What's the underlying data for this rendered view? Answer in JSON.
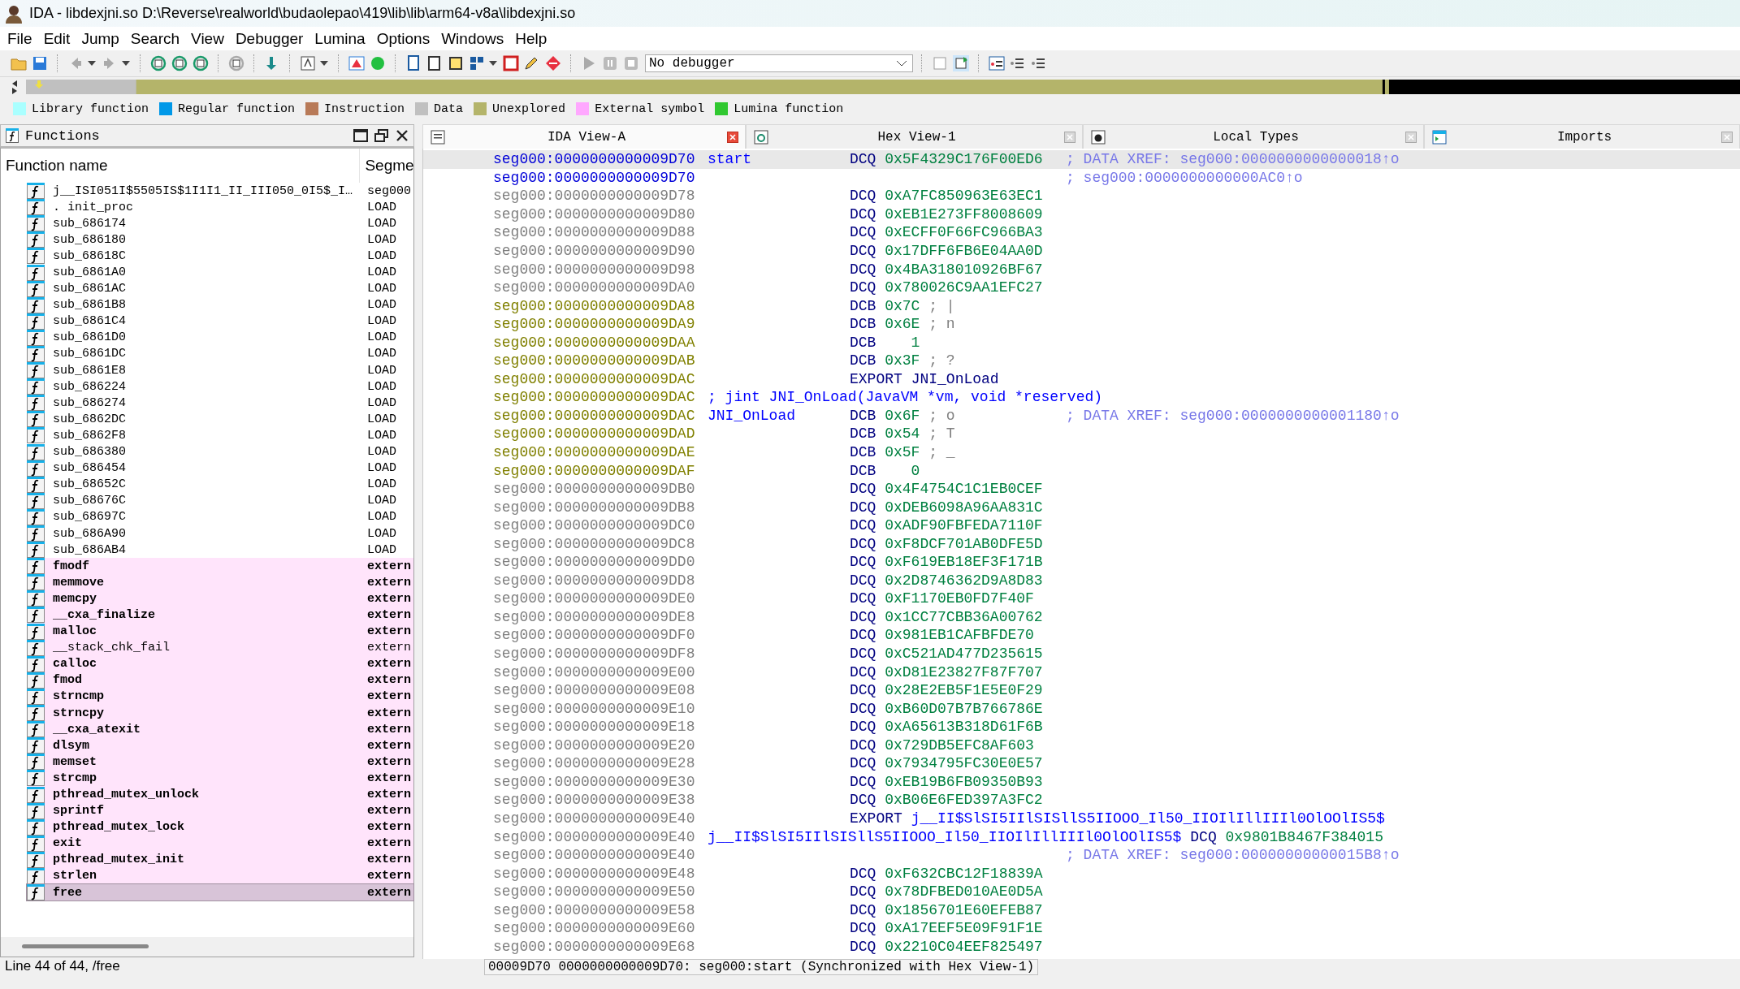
{
  "window": {
    "title": "IDA - libdexjni.so D:\\Reverse\\realworld\\budaolepao\\419\\lib\\lib\\arm64-v8a\\libdexjni.so"
  },
  "menu": [
    "File",
    "Edit",
    "Jump",
    "Search",
    "View",
    "Debugger",
    "Lumina",
    "Options",
    "Windows",
    "Help"
  ],
  "debugger_select": {
    "value": "No debugger"
  },
  "legend": [
    {
      "label": "Library function",
      "color": "#aaffff"
    },
    {
      "label": "Regular function",
      "color": "#0098e8"
    },
    {
      "label": "Instruction",
      "color": "#b87a58"
    },
    {
      "label": "Data",
      "color": "#c0c0c0"
    },
    {
      "label": "Unexplored",
      "color": "#b4b46a"
    },
    {
      "label": "External symbol",
      "color": "#ffa8ff"
    },
    {
      "label": "Lumina function",
      "color": "#30c830"
    }
  ],
  "functions_panel": {
    "title": "Functions",
    "columns": [
      "Function name",
      "Segme"
    ],
    "rows": [
      {
        "name": "j__ISI051I$5505IS$1I1I1_II_III050_0I5$_I…",
        "segment": "seg000",
        "kind": "local",
        "bold": false,
        "selected": false
      },
      {
        "name": ". init_proc",
        "segment": "LOAD",
        "kind": "local",
        "bold": false,
        "selected": false
      },
      {
        "name": "sub_686174",
        "segment": "LOAD",
        "kind": "local",
        "bold": false,
        "selected": false
      },
      {
        "name": "sub_686180",
        "segment": "LOAD",
        "kind": "local",
        "bold": false,
        "selected": false
      },
      {
        "name": "sub_68618C",
        "segment": "LOAD",
        "kind": "local",
        "bold": false,
        "selected": false
      },
      {
        "name": "sub_6861A0",
        "segment": "LOAD",
        "kind": "local",
        "bold": false,
        "selected": false
      },
      {
        "name": "sub_6861AC",
        "segment": "LOAD",
        "kind": "local",
        "bold": false,
        "selected": false
      },
      {
        "name": "sub_6861B8",
        "segment": "LOAD",
        "kind": "local",
        "bold": false,
        "selected": false
      },
      {
        "name": "sub_6861C4",
        "segment": "LOAD",
        "kind": "local",
        "bold": false,
        "selected": false
      },
      {
        "name": "sub_6861D0",
        "segment": "LOAD",
        "kind": "local",
        "bold": false,
        "selected": false
      },
      {
        "name": "sub_6861DC",
        "segment": "LOAD",
        "kind": "local",
        "bold": false,
        "selected": false
      },
      {
        "name": "sub_6861E8",
        "segment": "LOAD",
        "kind": "local",
        "bold": false,
        "selected": false
      },
      {
        "name": "sub_686224",
        "segment": "LOAD",
        "kind": "local",
        "bold": false,
        "selected": false
      },
      {
        "name": "sub_686274",
        "segment": "LOAD",
        "kind": "local",
        "bold": false,
        "selected": false
      },
      {
        "name": "sub_6862DC",
        "segment": "LOAD",
        "kind": "local",
        "bold": false,
        "selected": false
      },
      {
        "name": "sub_6862F8",
        "segment": "LOAD",
        "kind": "local",
        "bold": false,
        "selected": false
      },
      {
        "name": "sub_686380",
        "segment": "LOAD",
        "kind": "local",
        "bold": false,
        "selected": false
      },
      {
        "name": "sub_686454",
        "segment": "LOAD",
        "kind": "local",
        "bold": false,
        "selected": false
      },
      {
        "name": "sub_68652C",
        "segment": "LOAD",
        "kind": "local",
        "bold": false,
        "selected": false
      },
      {
        "name": "sub_68676C",
        "segment": "LOAD",
        "kind": "local",
        "bold": false,
        "selected": false
      },
      {
        "name": "sub_68697C",
        "segment": "LOAD",
        "kind": "local",
        "bold": false,
        "selected": false
      },
      {
        "name": "sub_686A90",
        "segment": "LOAD",
        "kind": "local",
        "bold": false,
        "selected": false
      },
      {
        "name": "sub_686AB4",
        "segment": "LOAD",
        "kind": "local",
        "bold": false,
        "selected": false
      },
      {
        "name": "fmodf",
        "segment": "extern",
        "kind": "extern",
        "bold": true,
        "selected": false
      },
      {
        "name": "memmove",
        "segment": "extern",
        "kind": "extern",
        "bold": true,
        "selected": false
      },
      {
        "name": "memcpy",
        "segment": "extern",
        "kind": "extern",
        "bold": true,
        "selected": false
      },
      {
        "name": "__cxa_finalize",
        "segment": "extern",
        "kind": "extern",
        "bold": true,
        "selected": false
      },
      {
        "name": "malloc",
        "segment": "extern",
        "kind": "extern",
        "bold": true,
        "selected": false
      },
      {
        "name": "__stack_chk_fail",
        "segment": "extern",
        "kind": "extern",
        "bold": false,
        "selected": false
      },
      {
        "name": "calloc",
        "segment": "extern",
        "kind": "extern",
        "bold": true,
        "selected": false
      },
      {
        "name": "fmod",
        "segment": "extern",
        "kind": "extern",
        "bold": true,
        "selected": false
      },
      {
        "name": "strncmp",
        "segment": "extern",
        "kind": "extern",
        "bold": true,
        "selected": false
      },
      {
        "name": "strncpy",
        "segment": "extern",
        "kind": "extern",
        "bold": true,
        "selected": false
      },
      {
        "name": "__cxa_atexit",
        "segment": "extern",
        "kind": "extern",
        "bold": true,
        "selected": false
      },
      {
        "name": "dlsym",
        "segment": "extern",
        "kind": "extern",
        "bold": true,
        "selected": false
      },
      {
        "name": "memset",
        "segment": "extern",
        "kind": "extern",
        "bold": true,
        "selected": false
      },
      {
        "name": "strcmp",
        "segment": "extern",
        "kind": "extern",
        "bold": true,
        "selected": false
      },
      {
        "name": "pthread_mutex_unlock",
        "segment": "extern",
        "kind": "extern",
        "bold": true,
        "selected": false
      },
      {
        "name": "sprintf",
        "segment": "extern",
        "kind": "extern",
        "bold": true,
        "selected": false
      },
      {
        "name": "pthread_mutex_lock",
        "segment": "extern",
        "kind": "extern",
        "bold": true,
        "selected": false
      },
      {
        "name": "exit",
        "segment": "extern",
        "kind": "extern",
        "bold": true,
        "selected": false
      },
      {
        "name": "pthread_mutex_init",
        "segment": "extern",
        "kind": "extern",
        "bold": true,
        "selected": false
      },
      {
        "name": "strlen",
        "segment": "extern",
        "kind": "extern",
        "bold": true,
        "selected": false
      },
      {
        "name": "free",
        "segment": "extern",
        "kind": "extern",
        "bold": true,
        "selected": true
      }
    ],
    "status": "Line 44 of 44, /free"
  },
  "tabs": [
    {
      "label": "IDA View-A",
      "selected": true
    },
    {
      "label": "Hex View-1",
      "selected": false
    },
    {
      "label": "Local Types",
      "selected": false
    },
    {
      "label": "Imports",
      "selected": false
    }
  ],
  "disassembly": [
    {
      "kind": "head",
      "address": "seg000:0000000000009D70",
      "selected": true,
      "label": "start",
      "mnemonic": "DCQ",
      "operand": "0x5F4329C176F00ED6",
      "comment": "; DATA XREF: seg000:0000000000000018↑o"
    },
    {
      "kind": "head",
      "address": "seg000:0000000000009D70",
      "selected": false,
      "comment": "; seg000:0000000000000AC0↑o"
    },
    {
      "kind": "data",
      "address": "seg000:0000000000009D78",
      "selected": false,
      "mnemonic": "DCQ",
      "operand": "0xA7FC850963E63EC1"
    },
    {
      "kind": "data",
      "address": "seg000:0000000000009D80",
      "selected": false,
      "mnemonic": "DCQ",
      "operand": "0xEB1E273FF8008609"
    },
    {
      "kind": "data",
      "address": "seg000:0000000000009D88",
      "selected": false,
      "mnemonic": "DCQ",
      "operand": "0xECFF0F66FC966BA3"
    },
    {
      "kind": "data",
      "address": "seg000:0000000000009D90",
      "selected": false,
      "mnemonic": "DCQ",
      "operand": "0x17DFF6FB6E04AA0D"
    },
    {
      "kind": "data",
      "address": "seg000:0000000000009D98",
      "selected": false,
      "mnemonic": "DCQ",
      "operand": "0x4BA318010926BF67"
    },
    {
      "kind": "data",
      "address": "seg000:0000000000009DA0",
      "selected": false,
      "mnemonic": "DCQ",
      "operand": "0x780026C9AA1EFC27"
    },
    {
      "kind": "bytes",
      "address": "seg000:0000000000009DA8",
      "selected": false,
      "mnemonic": "DCB",
      "operand": "0x7C",
      "char": "; |"
    },
    {
      "kind": "bytes",
      "address": "seg000:0000000000009DA9",
      "selected": false,
      "mnemonic": "DCB",
      "operand": "0x6E",
      "char": "; n"
    },
    {
      "kind": "bytes",
      "address": "seg000:0000000000009DAA",
      "selected": false,
      "mnemonic": "DCB",
      "operand": "   1"
    },
    {
      "kind": "bytes",
      "address": "seg000:0000000000009DAB",
      "selected": false,
      "mnemonic": "DCB",
      "operand": "0x3F",
      "char": "; ?"
    },
    {
      "kind": "bytes",
      "address": "seg000:0000000000009DAC",
      "selected": false,
      "mnemonic": "EXPORT",
      "symbol": "JNI_OnLoad"
    },
    {
      "kind": "bytes",
      "address": "seg000:0000000000009DAC",
      "selected": false,
      "prototype": "; jint JNI_OnLoad(JavaVM *vm, void *reserved)"
    },
    {
      "kind": "bytes",
      "address": "seg000:0000000000009DAC",
      "selected": false,
      "label": "JNI_OnLoad",
      "mnemonic": "DCB",
      "operand": "0x6F",
      "char": "; o",
      "comment": "; DATA XREF: seg000:0000000000001180↑o"
    },
    {
      "kind": "bytes",
      "address": "seg000:0000000000009DAD",
      "selected": false,
      "mnemonic": "DCB",
      "operand": "0x54",
      "char": "; T"
    },
    {
      "kind": "bytes",
      "address": "seg000:0000000000009DAE",
      "selected": false,
      "mnemonic": "DCB",
      "operand": "0x5F",
      "char": "; _"
    },
    {
      "kind": "bytes",
      "address": "seg000:0000000000009DAF",
      "selected": false,
      "mnemonic": "DCB",
      "operand": "   0"
    },
    {
      "kind": "data",
      "address": "seg000:0000000000009DB0",
      "selected": false,
      "mnemonic": "DCQ",
      "operand": "0x4F4754C1C1EB0CEF"
    },
    {
      "kind": "data",
      "address": "seg000:0000000000009DB8",
      "selected": false,
      "mnemonic": "DCQ",
      "operand": "0xDEB6098A96AA831C"
    },
    {
      "kind": "data",
      "address": "seg000:0000000000009DC0",
      "selected": false,
      "mnemonic": "DCQ",
      "operand": "0xADF90FBFEDA7110F"
    },
    {
      "kind": "data",
      "address": "seg000:0000000000009DC8",
      "selected": false,
      "mnemonic": "DCQ",
      "operand": "0xF8DCF701AB0DFE5D"
    },
    {
      "kind": "data",
      "address": "seg000:0000000000009DD0",
      "selected": false,
      "mnemonic": "DCQ",
      "operand": "0xF619EB18EF3F171B"
    },
    {
      "kind": "data",
      "address": "seg000:0000000000009DD8",
      "selected": false,
      "mnemonic": "DCQ",
      "operand": "0x2D8746362D9A8D83"
    },
    {
      "kind": "data",
      "address": "seg000:0000000000009DE0",
      "selected": false,
      "mnemonic": "DCQ",
      "operand": "0xF1170EB0FD7F40F"
    },
    {
      "kind": "data",
      "address": "seg000:0000000000009DE8",
      "selected": false,
      "mnemonic": "DCQ",
      "operand": "0x1CC77CBB36A00762"
    },
    {
      "kind": "data",
      "address": "seg000:0000000000009DF0",
      "selected": false,
      "mnemonic": "DCQ",
      "operand": "0x981EB1CAFBFDE70"
    },
    {
      "kind": "data",
      "address": "seg000:0000000000009DF8",
      "selected": false,
      "mnemonic": "DCQ",
      "operand": "0xC521AD477D235615"
    },
    {
      "kind": "data",
      "address": "seg000:0000000000009E00",
      "selected": false,
      "mnemonic": "DCQ",
      "operand": "0xD81E23827F87F707"
    },
    {
      "kind": "data",
      "address": "seg000:0000000000009E08",
      "selected": false,
      "mnemonic": "DCQ",
      "operand": "0x28E2EB5F1E5E0F29"
    },
    {
      "kind": "data",
      "address": "seg000:0000000000009E10",
      "selected": false,
      "mnemonic": "DCQ",
      "operand": "0xB60D07B7B766786E"
    },
    {
      "kind": "data",
      "address": "seg000:0000000000009E18",
      "selected": false,
      "mnemonic": "DCQ",
      "operand": "0xA65613B318D61F6B"
    },
    {
      "kind": "data",
      "address": "seg000:0000000000009E20",
      "selected": false,
      "mnemonic": "DCQ",
      "operand": "0x729DB5EFC8AF603"
    },
    {
      "kind": "data",
      "address": "seg000:0000000000009E28",
      "selected": false,
      "mnemonic": "DCQ",
      "operand": "0x7934795FC30E0E57"
    },
    {
      "kind": "data",
      "address": "seg000:0000000000009E30",
      "selected": false,
      "mnemonic": "DCQ",
      "operand": "0xEB19B6FB09350B93"
    },
    {
      "kind": "data",
      "address": "seg000:0000000000009E38",
      "selected": false,
      "mnemonic": "DCQ",
      "operand": "0xB06E6FED397A3FC2"
    },
    {
      "kind": "data",
      "address": "seg000:0000000000009E40",
      "selected": false,
      "mnemonic": "EXPORT",
      "symbol": "j__II$SlSI5IIlSISllS5IIOOO_Il50_IIOIlIllIIIl0OlOOlIS5$"
    },
    {
      "kind": "data",
      "address": "seg000:0000000000009E40",
      "selected": false,
      "label": "j__II$SlSI5IIlSISllS5IIOOO_Il50_IIOIlIllIIIl0OlOOlIS5$",
      "mnemonic": "DCQ",
      "operand": "0x9801B8467F384015"
    },
    {
      "kind": "data",
      "address": "seg000:0000000000009E40",
      "selected": false,
      "comment": "; DATA XREF: seg000:00000000000015B8↑o"
    },
    {
      "kind": "data",
      "address": "seg000:0000000000009E48",
      "selected": false,
      "mnemonic": "DCQ",
      "operand": "0xF632CBC12F18839A"
    },
    {
      "kind": "data",
      "address": "seg000:0000000000009E50",
      "selected": false,
      "mnemonic": "DCQ",
      "operand": "0x78DFBED010AE0D5A"
    },
    {
      "kind": "data",
      "address": "seg000:0000000000009E58",
      "selected": false,
      "mnemonic": "DCQ",
      "operand": "0x1856701E60EFEB87"
    },
    {
      "kind": "data",
      "address": "seg000:0000000000009E60",
      "selected": false,
      "mnemonic": "DCQ",
      "operand": "0xA17EEF5E09F91F1E"
    },
    {
      "kind": "data",
      "address": "seg000:0000000000009E68",
      "selected": false,
      "mnemonic": "DCQ",
      "operand": "0x2210C04EEF825497"
    }
  ],
  "status_bar": "00009D70 0000000000009D70: seg000:start (Synchronized with Hex View-1)"
}
